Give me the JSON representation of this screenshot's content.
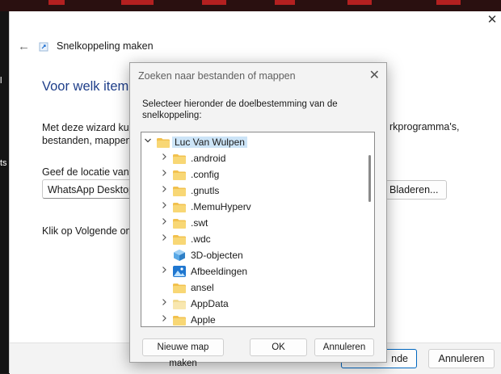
{
  "wizard": {
    "title": "Snelkoppeling maken",
    "heading": "Voor welk item w",
    "description_line1": "Met deze wizard kun",
    "description_line1_right": "rkprogramma's,",
    "description_line2": "bestanden, mappen,",
    "location_label": "Geef de locatie van h",
    "location_value": "WhatsApp Desktop",
    "browse_button": "Bladeren...",
    "next_hint": "Klik op Volgende om",
    "next_button": "nde",
    "cancel_button": "Annuleren",
    "close_glyph": "✕",
    "back_glyph": "←"
  },
  "background": {
    "left_text_1": "l",
    "left_text_2": "ts"
  },
  "dialog": {
    "title": "Zoeken naar bestanden of mappen",
    "instruction": "Selecteer hieronder de doelbestemming van de snelkoppeling:",
    "tree": [
      {
        "label": "Luc Van Wulpen",
        "level": 0,
        "expanded": true,
        "icon": "folder-icon",
        "selected": true
      },
      {
        "label": ".android",
        "level": 1,
        "expandable": true,
        "icon": "folder-icon"
      },
      {
        "label": ".config",
        "level": 1,
        "expandable": true,
        "icon": "folder-icon"
      },
      {
        "label": ".gnutls",
        "level": 1,
        "expandable": true,
        "icon": "folder-icon"
      },
      {
        "label": ".MemuHyperv",
        "level": 1,
        "expandable": true,
        "icon": "folder-icon"
      },
      {
        "label": ".swt",
        "level": 1,
        "expandable": true,
        "icon": "folder-icon"
      },
      {
        "label": ".wdc",
        "level": 1,
        "expandable": true,
        "icon": "folder-icon"
      },
      {
        "label": "3D-objecten",
        "level": 1,
        "expandable": false,
        "icon": "3d-objects-icon"
      },
      {
        "label": "Afbeeldingen",
        "level": 1,
        "expandable": true,
        "icon": "pictures-icon"
      },
      {
        "label": "ansel",
        "level": 1,
        "expandable": false,
        "icon": "folder-icon"
      },
      {
        "label": "AppData",
        "level": 1,
        "expandable": true,
        "icon": "folder-light-icon"
      },
      {
        "label": "Apple",
        "level": 1,
        "expandable": true,
        "icon": "folder-icon"
      }
    ],
    "new_folder_button": "Nieuwe map maken",
    "ok_button": "OK",
    "cancel_button": "Annuleren",
    "close_glyph": "✕"
  },
  "colors": {
    "accent": "#0067c0",
    "heading": "#1f3f8a",
    "folder": "#f2c14e",
    "selection": "#cce4f7"
  }
}
